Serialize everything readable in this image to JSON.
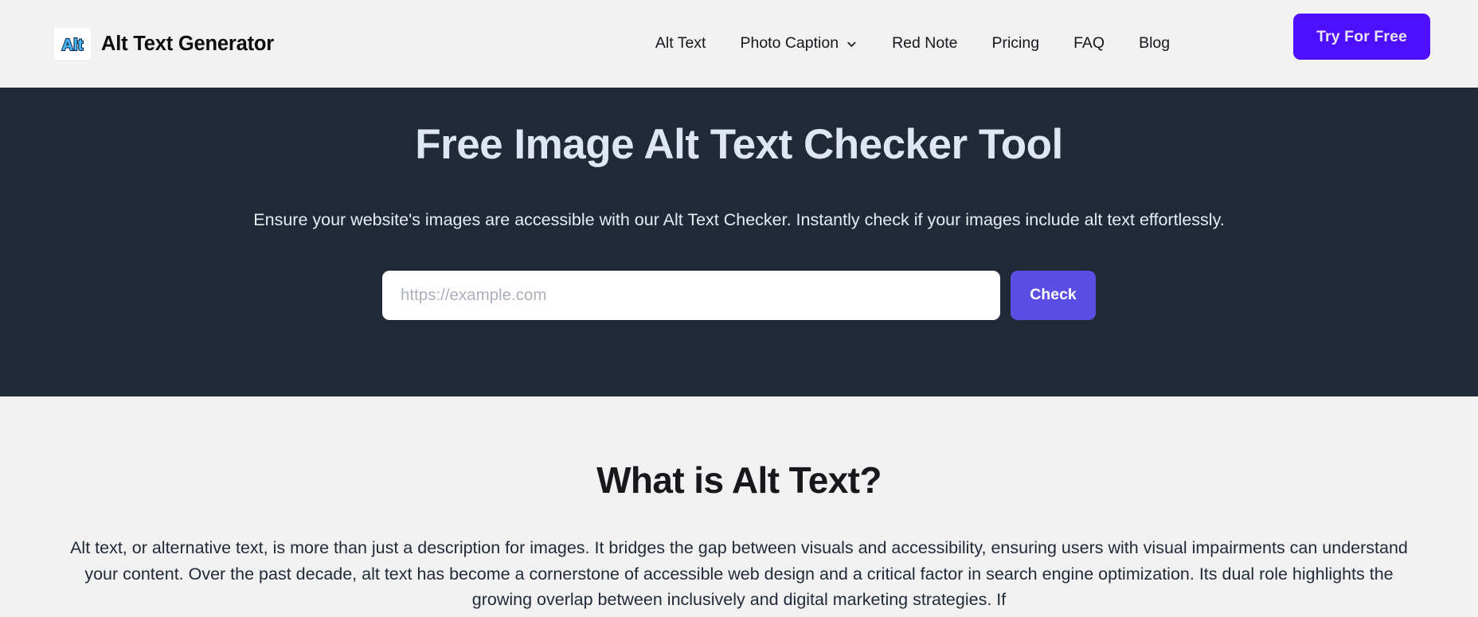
{
  "header": {
    "brand": {
      "logo_icon": "alt-logo-icon",
      "logo_text": "Alt",
      "name": "Alt Text Generator"
    },
    "nav": [
      {
        "label": "Alt Text",
        "has_dropdown": false
      },
      {
        "label": "Photo Caption",
        "has_dropdown": true,
        "dropdown_icon": "chevron-down-icon"
      },
      {
        "label": "Red Note",
        "has_dropdown": false
      },
      {
        "label": "Pricing",
        "has_dropdown": false
      },
      {
        "label": "FAQ",
        "has_dropdown": false
      },
      {
        "label": "Blog",
        "has_dropdown": false
      }
    ],
    "cta_label": "Try For Free",
    "cta_color": "#4f0fff",
    "background": "#f1f1f1"
  },
  "hero": {
    "title": "Free Image Alt Text Checker Tool",
    "subtitle": "Ensure your website's images are accessible with our Alt Text Checker. Instantly check if your images include alt text effortlessly.",
    "input": {
      "placeholder": "https://example.com",
      "value": ""
    },
    "submit_label": "Check",
    "submit_color": "#5b4ee5",
    "background": "#1f2937",
    "title_color": "#dfe6f2"
  },
  "content": {
    "title": "What is Alt Text?",
    "paragraph": "Alt text, or alternative text, is more than just a description for images. It bridges the gap between visuals and accessibility, ensuring users with visual impairments can understand your content. Over the past decade, alt text has become a cornerstone of accessible web design and a critical factor in search engine optimization. Its dual role highlights the growing overlap between inclusively and digital marketing strategies. If"
  }
}
